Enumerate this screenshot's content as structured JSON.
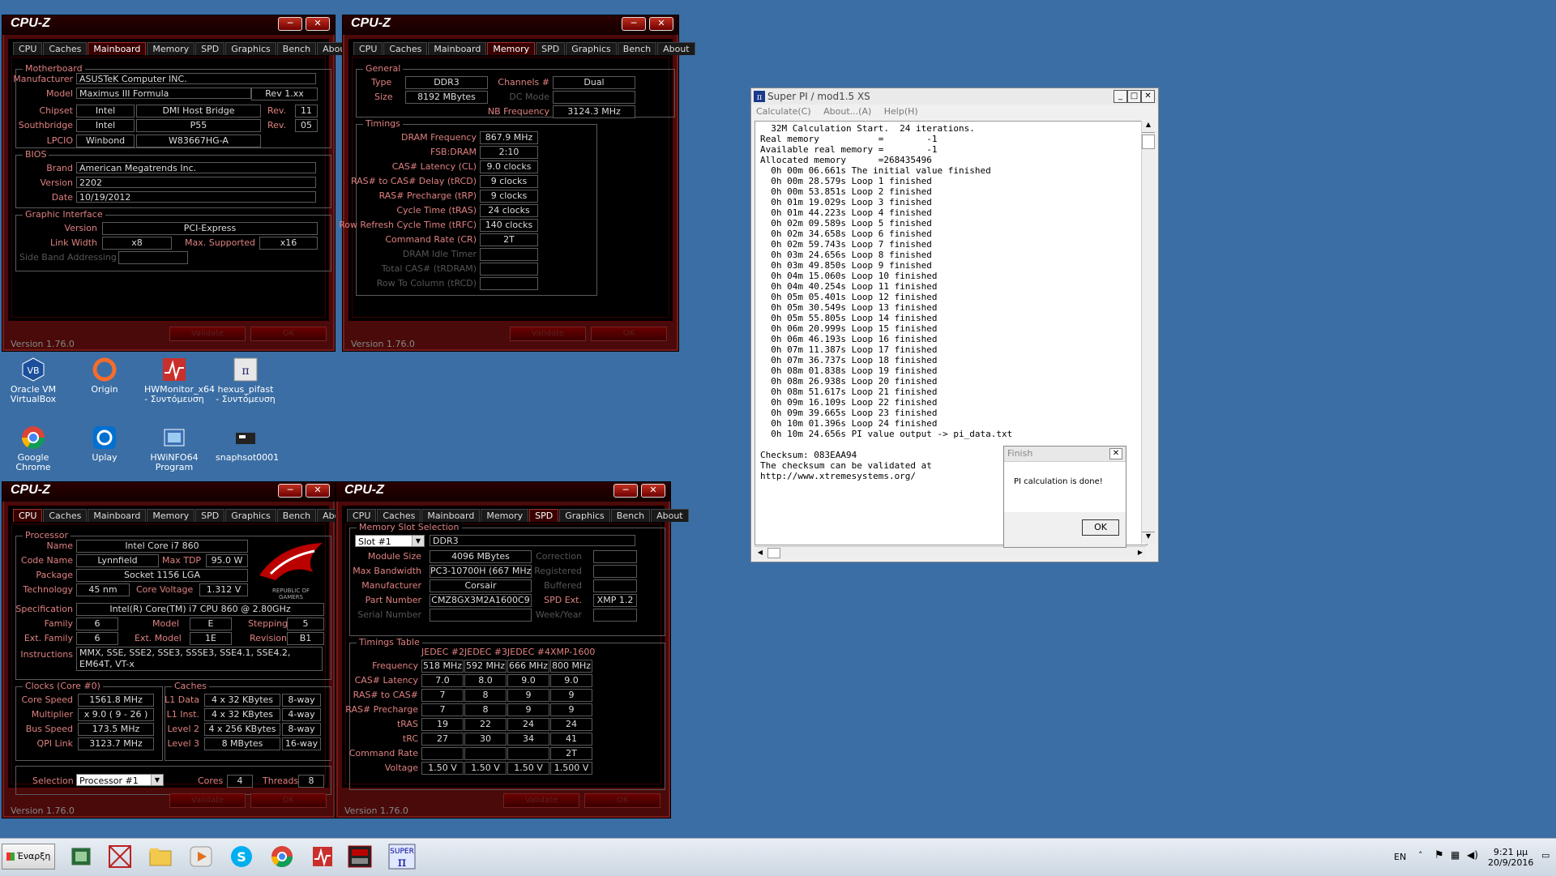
{
  "cpuz_common": {
    "title": "CPU-Z",
    "version": "Version 1.76.0",
    "tabs": [
      "CPU",
      "Caches",
      "Mainboard",
      "Memory",
      "SPD",
      "Graphics",
      "Bench",
      "About"
    ],
    "btn_validate": "Validate",
    "btn_ok": "OK"
  },
  "mainboard": {
    "group_motherboard": "Motherboard",
    "manufacturer_label": "Manufacturer",
    "manufacturer": "ASUSTeK Computer INC.",
    "model_label": "Model",
    "model": "Maximus III Formula",
    "model_rev": "Rev 1.xx",
    "chipset_label": "Chipset",
    "chipset_vendor": "Intel",
    "chipset_name": "DMI Host Bridge",
    "chipset_rev_label": "Rev.",
    "chipset_rev": "11",
    "southbridge_label": "Southbridge",
    "sb_vendor": "Intel",
    "sb_name": "P55",
    "sb_rev_label": "Rev.",
    "sb_rev": "05",
    "lpcio_label": "LPCIO",
    "lpcio_vendor": "Winbond",
    "lpcio_name": "W83667HG-A",
    "group_bios": "BIOS",
    "brand_label": "Brand",
    "brand": "American Megatrends Inc.",
    "version_label": "Version",
    "version": "2202",
    "date_label": "Date",
    "date": "10/19/2012",
    "group_graphic": "Graphic Interface",
    "gi_version_label": "Version",
    "gi_version": "PCI-Express",
    "link_width_label": "Link Width",
    "link_width": "x8",
    "max_supported_label": "Max. Supported",
    "max_supported": "x16",
    "side_band_label": "Side Band Addressing"
  },
  "memory": {
    "group_general": "General",
    "type_label": "Type",
    "type": "DDR3",
    "size_label": "Size",
    "size": "8192 MBytes",
    "channels_label": "Channels #",
    "channels": "Dual",
    "dc_mode_label": "DC Mode",
    "nb_freq_label": "NB Frequency",
    "nb_freq": "3124.3 MHz",
    "group_timings": "Timings",
    "rows": [
      {
        "label": "DRAM Frequency",
        "value": "867.9 MHz"
      },
      {
        "label": "FSB:DRAM",
        "value": "2:10"
      },
      {
        "label": "CAS# Latency (CL)",
        "value": "9.0 clocks"
      },
      {
        "label": "RAS# to CAS# Delay (tRCD)",
        "value": "9 clocks"
      },
      {
        "label": "RAS# Precharge (tRP)",
        "value": "9 clocks"
      },
      {
        "label": "Cycle Time (tRAS)",
        "value": "24 clocks"
      },
      {
        "label": "Row Refresh Cycle Time (tRFC)",
        "value": "140 clocks"
      },
      {
        "label": "Command Rate (CR)",
        "value": "2T"
      },
      {
        "label": "DRAM Idle Timer",
        "value": ""
      },
      {
        "label": "Total CAS# (tRDRAM)",
        "value": ""
      },
      {
        "label": "Row To Column (tRCD)",
        "value": ""
      }
    ]
  },
  "cpu": {
    "group_processor": "Processor",
    "name_label": "Name",
    "name": "Intel Core i7 860",
    "codename_label": "Code Name",
    "codename": "Lynnfield",
    "maxtdp_label": "Max TDP",
    "maxtdp": "95.0 W",
    "package_label": "Package",
    "package": "Socket 1156 LGA",
    "technology_label": "Technology",
    "technology": "45 nm",
    "core_voltage_label": "Core Voltage",
    "core_voltage": "1.312 V",
    "spec_label": "Specification",
    "spec": "Intel(R) Core(TM) i7 CPU       860  @ 2.80GHz",
    "family_label": "Family",
    "family": "6",
    "model_label": "Model",
    "model": "E",
    "stepping_label": "Stepping",
    "stepping": "5",
    "ext_family_label": "Ext. Family",
    "ext_family": "6",
    "ext_model_label": "Ext. Model",
    "ext_model": "1E",
    "revision_label": "Revision",
    "revision": "B1",
    "instructions_label": "Instructions",
    "instructions": "MMX, SSE, SSE2, SSE3, SSSE3, SSE4.1, SSE4.2, EM64T, VT-x",
    "logo_line1": "REPUBLIC OF",
    "logo_line2": "GAMERS",
    "group_clocks": "Clocks (Core #0)",
    "core_speed_label": "Core Speed",
    "core_speed": "1561.8 MHz",
    "multiplier_label": "Multiplier",
    "multiplier": "x 9.0 ( 9 - 26 )",
    "bus_speed_label": "Bus Speed",
    "bus_speed": "173.5 MHz",
    "qpi_label": "QPI Link",
    "qpi": "3123.7 MHz",
    "group_caches": "Caches",
    "l1d_label": "L1 Data",
    "l1d": "4 x 32 KBytes",
    "l1d_way": "8-way",
    "l1i_label": "L1 Inst.",
    "l1i": "4 x 32 KBytes",
    "l1i_way": "4-way",
    "l2_label": "Level 2",
    "l2": "4 x 256 KBytes",
    "l2_way": "8-way",
    "l3_label": "Level 3",
    "l3": "8 MBytes",
    "l3_way": "16-way",
    "selection_label": "Selection",
    "selection": "Processor #1",
    "cores_label": "Cores",
    "cores": "4",
    "threads_label": "Threads",
    "threads": "8"
  },
  "spd": {
    "group_slot": "Memory Slot Selection",
    "slot": "Slot #1",
    "slot_type": "DDR3",
    "module_size_label": "Module Size",
    "module_size": "4096 MBytes",
    "max_bw_label": "Max Bandwidth",
    "max_bw": "PC3-10700H (667 MHz)",
    "manufacturer_label": "Manufacturer",
    "manufacturer": "Corsair",
    "part_label": "Part Number",
    "part": "CMZ8GX3M2A1600C9",
    "serial_label": "Serial Number",
    "correction_label": "Correction",
    "registered_label": "Registered",
    "buffered_label": "Buffered",
    "spd_ext_label": "SPD Ext.",
    "spd_ext": "XMP 1.2",
    "week_year_label": "Week/Year",
    "group_timings": "Timings Table",
    "headers": [
      "JEDEC #2",
      "JEDEC #3",
      "JEDEC #4",
      "XMP-1600"
    ],
    "rows": [
      {
        "label": "Frequency",
        "values": [
          "518 MHz",
          "592 MHz",
          "666 MHz",
          "800 MHz"
        ]
      },
      {
        "label": "CAS# Latency",
        "values": [
          "7.0",
          "8.0",
          "9.0",
          "9.0"
        ]
      },
      {
        "label": "RAS# to CAS#",
        "values": [
          "7",
          "8",
          "9",
          "9"
        ]
      },
      {
        "label": "RAS# Precharge",
        "values": [
          "7",
          "8",
          "9",
          "9"
        ]
      },
      {
        "label": "tRAS",
        "values": [
          "19",
          "22",
          "24",
          "24"
        ]
      },
      {
        "label": "tRC",
        "values": [
          "27",
          "30",
          "34",
          "41"
        ]
      },
      {
        "label": "Command Rate",
        "values": [
          "",
          "",
          "",
          "2T"
        ]
      },
      {
        "label": "Voltage",
        "values": [
          "1.50 V",
          "1.50 V",
          "1.50 V",
          "1.500 V"
        ]
      }
    ]
  },
  "desktop_icons": [
    {
      "label": "Oracle VM VirtualBox"
    },
    {
      "label": "Origin"
    },
    {
      "label": "HWMonitor_x64 - Συντόμευση"
    },
    {
      "label": "hexus_pifast - Συντόμευση"
    },
    {
      "label": "Google Chrome"
    },
    {
      "label": "Uplay"
    },
    {
      "label": "HWiNFO64 Program"
    },
    {
      "label": "snaphsot0001"
    }
  ],
  "superpi": {
    "title": "Super PI / mod1.5 XS",
    "menu": [
      "Calculate(C)",
      "About...(A)",
      "Help(H)"
    ],
    "output": "  32M Calculation Start.  24 iterations.\nReal memory           =        -1\nAvailable real memory =        -1\nAllocated memory      =268435496\n  0h 00m 06.661s The initial value finished\n  0h 00m 28.579s Loop 1 finished\n  0h 00m 53.851s Loop 2 finished\n  0h 01m 19.029s Loop 3 finished\n  0h 01m 44.223s Loop 4 finished\n  0h 02m 09.589s Loop 5 finished\n  0h 02m 34.658s Loop 6 finished\n  0h 02m 59.743s Loop 7 finished\n  0h 03m 24.656s Loop 8 finished\n  0h 03m 49.850s Loop 9 finished\n  0h 04m 15.060s Loop 10 finished\n  0h 04m 40.254s Loop 11 finished\n  0h 05m 05.401s Loop 12 finished\n  0h 05m 30.549s Loop 13 finished\n  0h 05m 55.805s Loop 14 finished\n  0h 06m 20.999s Loop 15 finished\n  0h 06m 46.193s Loop 16 finished\n  0h 07m 11.387s Loop 17 finished\n  0h 07m 36.737s Loop 18 finished\n  0h 08m 01.838s Loop 19 finished\n  0h 08m 26.938s Loop 20 finished\n  0h 08m 51.617s Loop 21 finished\n  0h 09m 16.109s Loop 22 finished\n  0h 09m 39.665s Loop 23 finished\n  0h 10m 01.396s Loop 24 finished\n  0h 10m 24.656s PI value output -> pi_data.txt\n\nChecksum: 083EAA94\nThe checksum can be validated at\nhttp://www.xtremesystems.org/"
  },
  "finish_dialog": {
    "title": "Finish",
    "message": "PI calculation is done!",
    "ok": "OK"
  },
  "taskbar": {
    "start_label": "Έναρξη",
    "lang": "EN",
    "time": "9:21 μμ",
    "date": "20/9/2016"
  }
}
